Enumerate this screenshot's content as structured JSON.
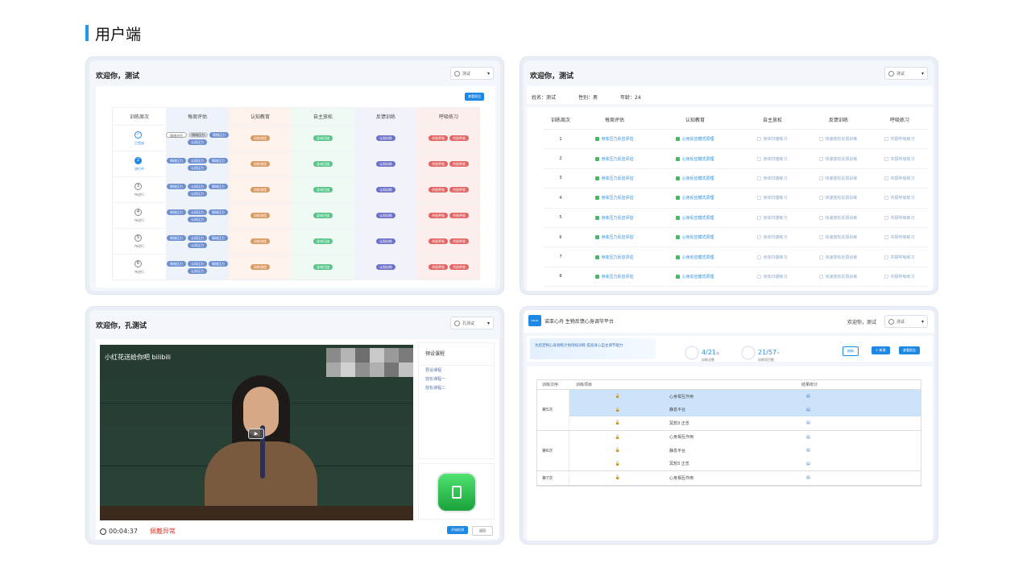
{
  "page_title": "用户端",
  "p1": {
    "welcome": "欢迎你，测试",
    "user": "测试",
    "report_button": "查看报告",
    "headers": [
      "训练周次",
      "每周评估",
      "认知教育",
      "自主放松",
      "反馈训练",
      "呼吸练习"
    ],
    "rows": [
      {
        "num": "✓",
        "status": "已完成",
        "state": "done",
        "eval": [
          [
            "情绪评估",
            "outline"
          ],
          [
            "情绪压力",
            "grey"
          ],
          [
            "情绪压力",
            "blue"
          ],
          [
            "认知压力",
            "blue"
          ]
        ],
        "edu": [
          "训练课程"
        ],
        "relax": [
          "身体扫描"
        ],
        "fb": [
          "认知训练"
        ],
        "breath": [
          "共振呼吸",
          "共振呼吸"
        ]
      },
      {
        "num": "2",
        "status": "进行中",
        "state": "active",
        "eval": [
          [
            "情绪压力",
            "blue"
          ],
          [
            "认知压力",
            "blue"
          ],
          [
            "情绪压力",
            "blue"
          ],
          [
            "认知压力",
            "blue"
          ]
        ],
        "edu": [
          "训练课程"
        ],
        "relax": [
          "身体扫描"
        ],
        "fb": [
          "认知训练"
        ],
        "breath": [
          "共振呼吸",
          "共振呼吸"
        ]
      },
      {
        "num": "3",
        "status": "待进行",
        "state": "todo",
        "eval": [
          [
            "情绪压力",
            "blue"
          ],
          [
            "认知压力",
            "blue"
          ],
          [
            "情绪压力",
            "blue"
          ],
          [
            "认知压力",
            "blue"
          ]
        ],
        "edu": [
          "训练课程"
        ],
        "relax": [
          "身体扫描"
        ],
        "fb": [
          "认知训练"
        ],
        "breath": [
          "共振呼吸",
          "共振呼吸"
        ]
      },
      {
        "num": "4",
        "status": "待进行",
        "state": "todo",
        "eval": [
          [
            "情绪压力",
            "blue"
          ],
          [
            "认知压力",
            "blue"
          ],
          [
            "情绪压力",
            "blue"
          ],
          [
            "认知压力",
            "blue"
          ]
        ],
        "edu": [
          "训练课程"
        ],
        "relax": [
          "身体扫描"
        ],
        "fb": [
          "认知训练"
        ],
        "breath": [
          "共振呼吸",
          "共振呼吸"
        ]
      },
      {
        "num": "5",
        "status": "待进行",
        "state": "todo",
        "eval": [
          [
            "情绪压力",
            "blue"
          ],
          [
            "认知压力",
            "blue"
          ],
          [
            "情绪压力",
            "blue"
          ],
          [
            "认知压力",
            "blue"
          ]
        ],
        "edu": [
          "训练课程"
        ],
        "relax": [
          "身体扫描"
        ],
        "fb": [
          "认知训练"
        ],
        "breath": [
          "共振呼吸",
          "共振呼吸"
        ]
      },
      {
        "num": "6",
        "status": "待进行",
        "state": "todo",
        "eval": [
          [
            "情绪压力",
            "blue"
          ],
          [
            "认知压力",
            "blue"
          ],
          [
            "情绪压力",
            "blue"
          ],
          [
            "认知压力",
            "blue"
          ]
        ],
        "edu": [
          "训练课程"
        ],
        "relax": [
          "身体扫描"
        ],
        "fb": [
          "认知训练"
        ],
        "breath": [
          "共振呼吸",
          "共振呼吸"
        ]
      }
    ]
  },
  "p2": {
    "welcome": "欢迎你，测试",
    "user": "测试",
    "name": "姓名：测试",
    "gender": "性别：男",
    "age": "年龄：24",
    "headers": [
      "训练周次",
      "每周评估",
      "认知教育",
      "自主放松",
      "反馈训练",
      "呼吸练习"
    ],
    "cells": [
      "身体压力反应评估",
      "心身反应模式原理",
      "身体扫描练习",
      "快速放松反馈训练",
      "共振呼吸练习"
    ],
    "rows": [
      "1",
      "2",
      "3",
      "4",
      "5",
      "6",
      "7",
      "8"
    ]
  },
  "p3": {
    "welcome": "欢迎你，孔测试",
    "user": "孔测试",
    "video_caption": "小红花送给你吧 bilibili",
    "course_header": "预设课程",
    "courses": [
      "预设课程",
      "放松课程一",
      "放松课程二"
    ],
    "time": "00:04:37",
    "warning": "佩戴异常",
    "start_button": "开始检测",
    "back_button": "返回"
  },
  "p4": {
    "logo": "WEAR",
    "app_name": "诺亚心舟 生物反馈心身调节平台",
    "welcome": "欢迎你，测试",
    "user": "测试",
    "banner": "为您定制心身调练计划持续训练 提高身心自主调节能力",
    "stat1_num": "4/21",
    "stat1_unit": "次",
    "stat1_label": "训练总数",
    "stat2_num": "21/57",
    "stat2_unit": "个",
    "stat2_label": "训练项目数",
    "refresh": "刷新",
    "add": "+ 新建",
    "report": "查看报告",
    "headers": [
      "训练次序",
      "训练项目",
      "结果统计"
    ],
    "groups": [
      {
        "label": "第5次",
        "items": [
          "心身相互作用",
          "静息平台",
          "冥想3 正念"
        ],
        "hl": [
          true,
          true,
          false
        ]
      },
      {
        "label": "第6次",
        "items": [
          "心身相互作用",
          "静息平台",
          "冥想3 正念"
        ],
        "hl": [
          false,
          false,
          false
        ]
      },
      {
        "label": "第7次",
        "items": [
          "心身相互作用"
        ],
        "hl": [
          false
        ]
      }
    ]
  }
}
